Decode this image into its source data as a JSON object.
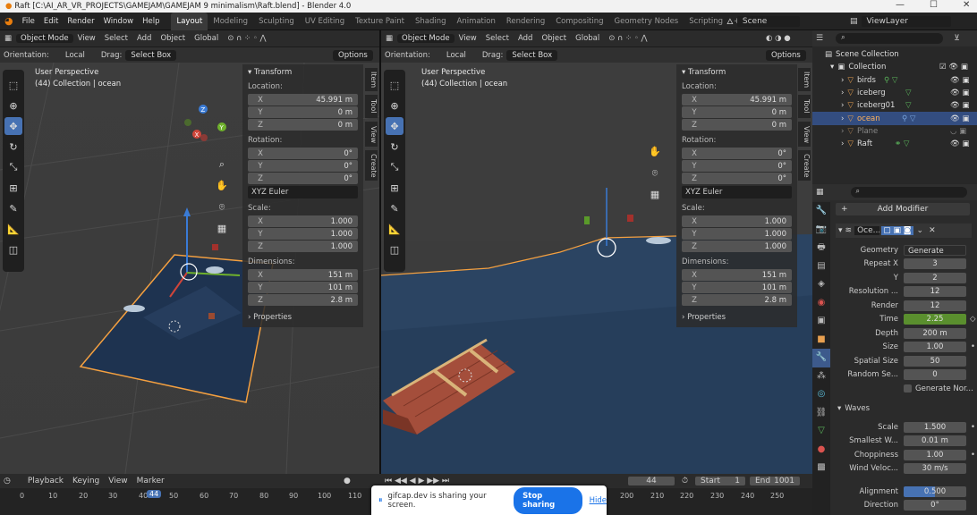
{
  "window": {
    "title": "Raft [C:\\AI_AR_VR_PROJECTS\\GAMEJAM\\GAMEJAM 9 minimalism\\Raft.blend] - Blender 4.0"
  },
  "menu": [
    "File",
    "Edit",
    "Render",
    "Window",
    "Help"
  ],
  "workspaces": [
    "Layout",
    "Modeling",
    "Sculpting",
    "UV Editing",
    "Texture Paint",
    "Shading",
    "Animation",
    "Rendering",
    "Compositing",
    "Geometry Nodes",
    "Scripting"
  ],
  "scene_name": "Scene",
  "view_layer": "ViewLayer",
  "viewport_header": {
    "mode": "Object Mode",
    "menus": [
      "View",
      "Select",
      "Add",
      "Object"
    ],
    "transform": "Global",
    "orientation_label": "Orientation:",
    "orientation_value": "Local",
    "drag_label": "Drag:",
    "drag_value": "Select Box",
    "options": "Options"
  },
  "viewport_left": {
    "persp": "User Perspective",
    "collection": "(44) Collection | ocean"
  },
  "viewport_right": {
    "persp": "User Perspective",
    "collection": "(44) Collection | ocean"
  },
  "transform_panel": {
    "title": "Transform",
    "location_label": "Location:",
    "location": {
      "x": "45.991 m",
      "y": "0 m",
      "z": "0 m"
    },
    "rotation_label": "Rotation:",
    "rotation": {
      "x": "0°",
      "y": "0°",
      "z": "0°"
    },
    "rotation_mode": "XYZ Euler",
    "scale_label": "Scale:",
    "scale": {
      "x": "1.000",
      "y": "1.000",
      "z": "1.000"
    },
    "dimensions_label": "Dimensions:",
    "dimensions": {
      "x": "151 m",
      "y": "101 m",
      "z": "2.8 m"
    },
    "properties": "Properties"
  },
  "side_tabs": [
    "Item",
    "Tool",
    "View",
    "Create"
  ],
  "outliner": {
    "search_placeholder": "",
    "root": "Scene Collection",
    "collection": "Collection",
    "items": [
      "birds",
      "iceberg",
      "iceberg01",
      "ocean",
      "Plane",
      "Raft"
    ]
  },
  "properties": {
    "add_modifier": "Add Modifier",
    "modifier_name": "Oce...",
    "rows": [
      {
        "label": "Geometry",
        "value": "Generate"
      },
      {
        "label": "Repeat X",
        "value": "3"
      },
      {
        "label": "Y",
        "value": "2"
      },
      {
        "label": "Resolution ...",
        "value": "12"
      },
      {
        "label": "Render",
        "value": "12"
      },
      {
        "label": "Time",
        "value": "2.25"
      },
      {
        "label": "Depth",
        "value": "200 m"
      },
      {
        "label": "Size",
        "value": "1.00"
      },
      {
        "label": "Spatial Size",
        "value": "50"
      },
      {
        "label": "Random Se...",
        "value": "0"
      }
    ],
    "generate_normals": "Generate Nor...",
    "waves_title": "Waves",
    "wave_rows": [
      {
        "label": "Scale",
        "value": "1.500"
      },
      {
        "label": "Smallest W...",
        "value": "0.01 m"
      },
      {
        "label": "Choppiness",
        "value": "1.00"
      },
      {
        "label": "Wind Veloc...",
        "value": "30 m/s"
      }
    ],
    "alignment_label": "Alignment",
    "alignment_value": "0.500",
    "direction_label": "Direction",
    "direction_value": "0°"
  },
  "timeline": {
    "menus": [
      "Playback",
      "Keying",
      "View",
      "Marker"
    ],
    "current_frame": "44",
    "start_label": "Start",
    "start": "1",
    "end_label": "End",
    "end": "1001",
    "ticks_left": [
      "0",
      "10",
      "20",
      "30",
      "40",
      "50",
      "60",
      "70",
      "80",
      "90",
      "100",
      "110"
    ],
    "ticks_right": [
      "200",
      "210",
      "220",
      "230",
      "240",
      "250"
    ]
  },
  "share_banner": {
    "text": "gifcap.dev is sharing your screen.",
    "stop": "Stop sharing",
    "hide": "Hide"
  },
  "colors": {
    "accent": "#4772b3",
    "time_green": "#5a8f2e",
    "selected_row": "#334d80"
  }
}
